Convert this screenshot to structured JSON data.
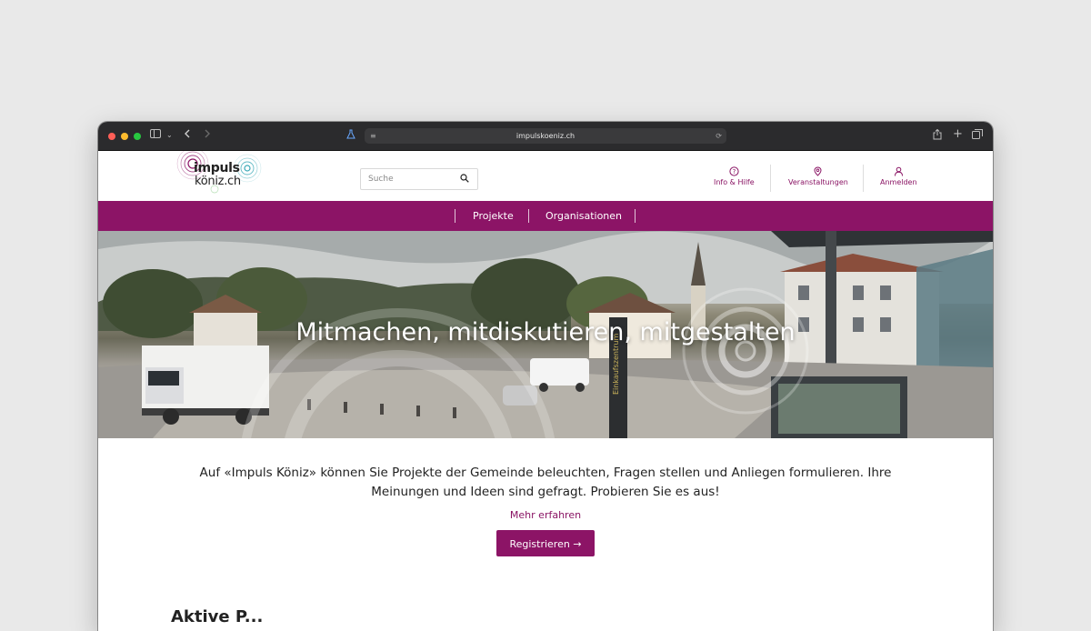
{
  "browser": {
    "url": "impulskoeniz.ch"
  },
  "logo": {
    "line1": "impuls",
    "line2": "köniz.ch",
    "colors": [
      "#8c1466",
      "#3aa9b6",
      "#222222"
    ]
  },
  "search": {
    "placeholder": "Suche",
    "icon": "search-icon"
  },
  "header_nav": [
    {
      "label": "Info & Hilfe",
      "icon": "question-circle-icon"
    },
    {
      "label": "Veranstaltungen",
      "icon": "calendar-pin-icon"
    },
    {
      "label": "Anmelden",
      "icon": "user-icon"
    }
  ],
  "main_nav": [
    {
      "label": "Projekte"
    },
    {
      "label": "Organisationen"
    }
  ],
  "hero": {
    "title": "Mitmachen, mitdiskutieren, mitgestalten",
    "sign_text": "Einkaufszentrum"
  },
  "intro": {
    "text": "Auf «Impuls Köniz» können Sie Projekte der Gemeinde beleuchten, Fragen stellen und Anliegen formulieren. Ihre Meinungen und Ideen sind gefragt. Probieren Sie es aus!",
    "more_link": "Mehr erfahren",
    "register_button": "Registrieren →"
  },
  "sections": {
    "next_title": "Aktive P..."
  },
  "colors": {
    "brand": "#8c1466",
    "page_bg": "#e9e9e9",
    "toolbar_bg": "#2b2b2d"
  }
}
